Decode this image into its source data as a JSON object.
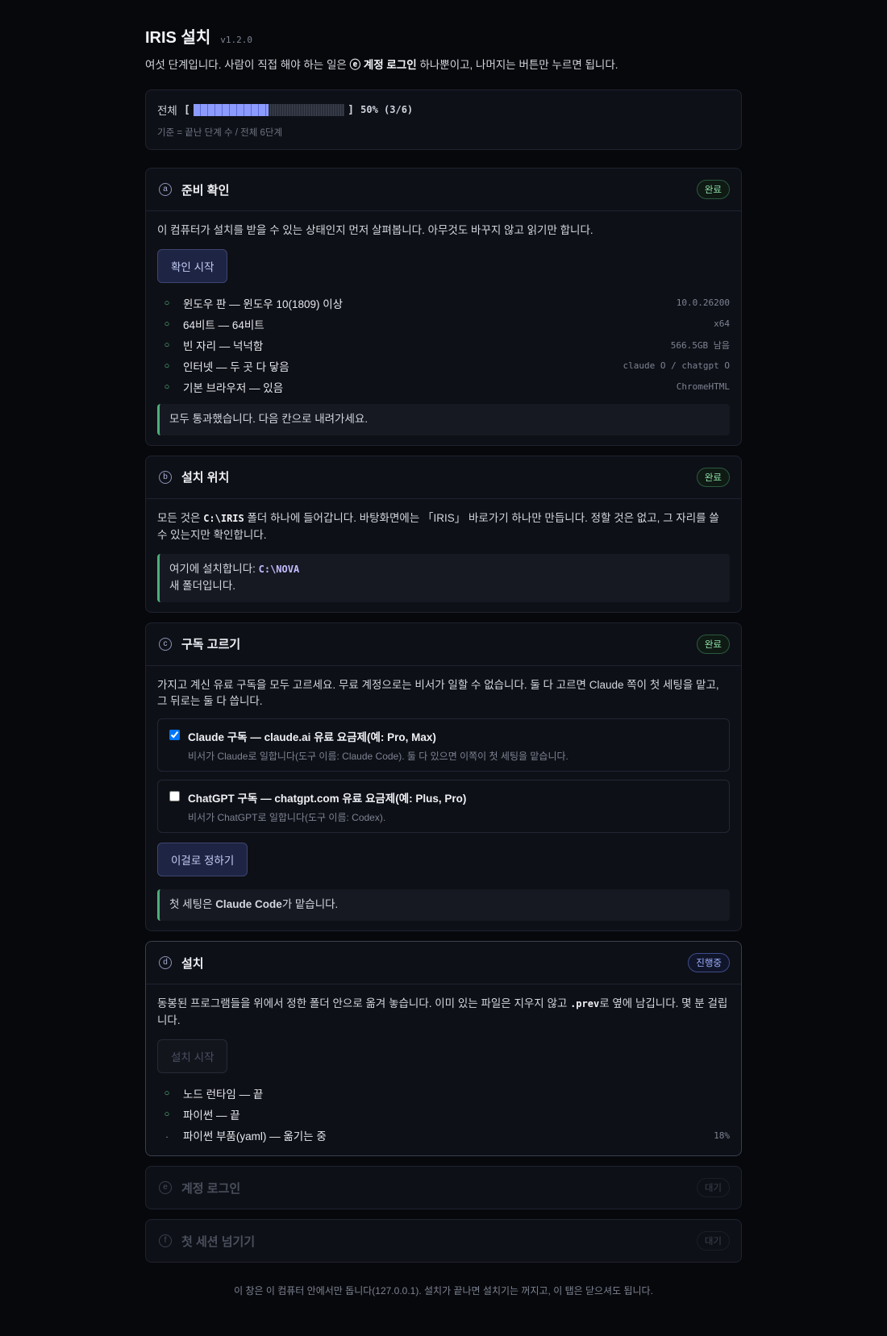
{
  "header": {
    "title": "IRIS 설치",
    "version": "v1.2.0",
    "intro_before": "여섯 단계입니다. 사람이 직접 해야 하는 일은 ",
    "intro_bold": "ⓔ 계정 로그인",
    "intro_after": " 하나뿐이고, 나머지는 버튼만 누르면 됩니다."
  },
  "overall": {
    "label": "전체",
    "progress": 0.5,
    "percent_text": "50% (3/6)",
    "note": "기준 = 끝난 단계 수 / 전체 6단계"
  },
  "steps": {
    "a": {
      "letter": "a",
      "title": "준비 확인",
      "status": "완료",
      "desc": "이 컴퓨터가 설치를 받을 수 있는 상태인지 먼저 살펴봅니다. 아무것도 바꾸지 않고 읽기만 합니다.",
      "button": "확인 시작",
      "checks": [
        {
          "mark": "○",
          "label": "윈도우 판 — 윈도우 10(1809) 이상",
          "value": "10.0.26200"
        },
        {
          "mark": "○",
          "label": "64비트 — 64비트",
          "value": "x64"
        },
        {
          "mark": "○",
          "label": "빈 자리 — 넉넉함",
          "value": "566.5GB 남음"
        },
        {
          "mark": "○",
          "label": "인터넷 — 두 곳 다 닿음",
          "value": "claude O / chatgpt O"
        },
        {
          "mark": "○",
          "label": "기본 브라우저 — 있음",
          "value": "ChromeHTML"
        }
      ],
      "callout": "모두 통과했습니다. 다음 칸으로 내려가세요."
    },
    "b": {
      "letter": "b",
      "title": "설치 위치",
      "status": "완료",
      "desc_before": "모든 것은 ",
      "desc_code": "C:\\IRIS",
      "desc_after": " 폴더 하나에 들어갑니다. 바탕화면에는 「IRIS」 바로가기 하나만 만듭니다. 정할 것은 없고, 그 자리를 쓸 수 있는지만 확인합니다.",
      "callout_line1": "여기에 설치합니다: ",
      "callout_path": "C:\\NOVA",
      "callout_line2": "새 폴더입니다."
    },
    "c": {
      "letter": "c",
      "title": "구독 고르기",
      "status": "완료",
      "desc": "가지고 계신 유료 구독을 모두 고르세요. 무료 계정으로는 비서가 일할 수 없습니다. 둘 다 고르면 Claude 쪽이 첫 세팅을 맡고, 그 뒤로는 둘 다 씁니다.",
      "options": [
        {
          "title": "Claude 구독 — claude.ai 유료 요금제(예: Pro, Max)",
          "sub": "비서가 Claude로 일합니다(도구 이름: Claude Code). 둘 다 있으면 이쪽이 첫 세팅을 맡습니다.",
          "checked": true
        },
        {
          "title": "ChatGPT 구독 — chatgpt.com 유료 요금제(예: Plus, Pro)",
          "sub": "비서가 ChatGPT로 일합니다(도구 이름: Codex).",
          "checked": false
        }
      ],
      "button": "이걸로 정하기",
      "callout_before": "첫 세팅은 ",
      "callout_bold": "Claude Code",
      "callout_after": "가 맡습니다."
    },
    "d": {
      "letter": "d",
      "title": "설치",
      "status": "진행중",
      "desc_before": "동봉된 프로그램들을 위에서 정한 폴더 안으로 옮겨 놓습니다. 이미 있는 파일은 지우지 않고 ",
      "desc_code": ".prev",
      "desc_after": "로 옆에 남깁니다. 몇 분 걸립니다.",
      "button": "설치 시작",
      "checks": [
        {
          "mark": "○",
          "label": "노드 런타임 — 끝",
          "value": ""
        },
        {
          "mark": "○",
          "label": "파이썬 — 끝",
          "value": ""
        },
        {
          "mark": ".",
          "label": "파이썬 부품(yaml) — 옮기는 중",
          "value": "18%"
        }
      ]
    },
    "e": {
      "letter": "e",
      "title": "계정 로그인",
      "status": "대기"
    },
    "f": {
      "letter": "f",
      "title": "첫 세션 넘기기",
      "status": "대기"
    }
  },
  "footer": "이 창은 이 컴퓨터 안에서만 돕니다(127.0.0.1). 설치가 끝나면 설치기는 꺼지고, 이 탭은 닫으셔도 됩니다.",
  "colors": {
    "accent": "#8c9bff",
    "success": "#5fd18a",
    "background": "#07080c"
  }
}
